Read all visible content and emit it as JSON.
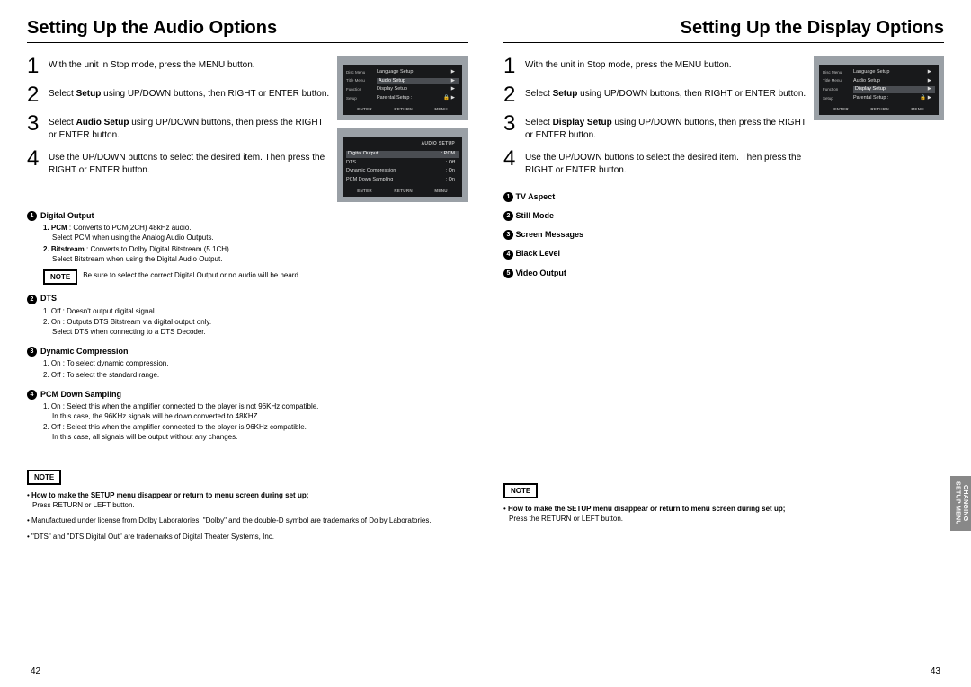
{
  "left": {
    "title": "Setting Up the Audio Options",
    "steps": [
      {
        "num": "1",
        "text": "With the unit in Stop mode, press the MENU button."
      },
      {
        "num": "2",
        "pre": "Select ",
        "bold": "Setup",
        "post": " using UP/DOWN buttons, then RIGHT or ENTER button."
      },
      {
        "num": "3",
        "pre": "Select ",
        "bold": "Audio Setup",
        "post": " using UP/DOWN buttons, then press the RIGHT or ENTER button."
      },
      {
        "num": "4",
        "text": "Use the UP/DOWN buttons to select the desired item. Then press the RIGHT or ENTER button."
      }
    ],
    "osd1": {
      "side": [
        "Disc Menu",
        "Title Menu",
        "Function",
        "Setup"
      ],
      "rows": [
        {
          "label": "Language Setup",
          "val": "▶"
        },
        {
          "label": "Audio Setup",
          "val": "▶",
          "hl": true
        },
        {
          "label": "Display Setup",
          "val": "▶"
        },
        {
          "label": "Parental Setup :",
          "val": "🔒 ▶"
        }
      ],
      "footer": [
        "ENTER",
        "RETURN",
        "MENU"
      ]
    },
    "osd2": {
      "title": "AUDIO SETUP",
      "rows": [
        {
          "label": "Digital Output",
          "val": ": PCM",
          "hl": true
        },
        {
          "label": "DTS",
          "val": ": Off"
        },
        {
          "label": "Dynamic Compression",
          "val": ": On"
        },
        {
          "label": "PCM Down Sampling",
          "val": ": On"
        }
      ],
      "footer": [
        "ENTER",
        "RETURN",
        "MENU"
      ]
    },
    "opts": {
      "o1": {
        "num": "1",
        "head": "Digital Output",
        "subs": [
          {
            "lead": "1. PCM",
            "text": " : Converts to PCM(2CH) 48kHz audio.",
            "cont": "Select PCM when using the Analog Audio Outputs."
          },
          {
            "lead": "2. Bitstream",
            "text": " : Converts to Dolby Digital Bitstream (5.1CH).",
            "cont": "Select Bitstream when using the Digital Audio Output."
          }
        ],
        "note": "Be sure to select the correct Digital Output or no audio will be heard."
      },
      "o2": {
        "num": "2",
        "head": "DTS",
        "subs": [
          {
            "lead": "",
            "text": "1. Off : Doesn't output digital signal."
          },
          {
            "lead": "",
            "text": "2. On : Outputs DTS Bitstream via digital output only.",
            "cont": "Select DTS when connecting to a DTS Decoder."
          }
        ]
      },
      "o3": {
        "num": "3",
        "head": "Dynamic Compression",
        "subs": [
          {
            "lead": "",
            "text": "1. On : To select dynamic compression."
          },
          {
            "lead": "",
            "text": "2. Off : To select the standard range."
          }
        ]
      },
      "o4": {
        "num": "4",
        "head": "PCM Down Sampling",
        "subs": [
          {
            "lead": "",
            "text": "1. On : Select this when the amplifier connected to the player is not 96KHz compatible.",
            "cont": "In this case, the 96KHz signals will be down converted to 48KHZ."
          },
          {
            "lead": "",
            "text": "2. Off : Select this when the amplifier connected to the player is 96KHz compatible.",
            "cont": "In this case, all signals will be output without any changes."
          }
        ]
      }
    },
    "footnote": {
      "label": "NOTE",
      "lines": [
        {
          "bold": "How to make the SETUP menu disappear or return to menu screen during set up;",
          "plain": "Press RETURN or LEFT button."
        },
        {
          "plain": "Manufactured under license from Dolby Laboratories. \"Dolby\" and the double-D symbol are trademarks of Dolby Laboratories."
        },
        {
          "plain": "\"DTS\" and \"DTS Digital Out\" are trademarks of Digital Theater Systems, Inc."
        }
      ]
    },
    "page": "42"
  },
  "right": {
    "title": "Setting Up the Display Options",
    "steps": [
      {
        "num": "1",
        "text": "With the unit in Stop mode, press the MENU button."
      },
      {
        "num": "2",
        "pre": "Select ",
        "bold": "Setup",
        "post": " using UP/DOWN buttons, then RIGHT or ENTER button."
      },
      {
        "num": "3",
        "pre": "Select ",
        "bold": "Display Setup",
        "post": " using UP/DOWN buttons, then press the RIGHT or ENTER button."
      },
      {
        "num": "4",
        "text": "Use the UP/DOWN buttons to select the desired item. Then press the RIGHT or ENTER button."
      }
    ],
    "osd1": {
      "side": [
        "Disc Menu",
        "Title Menu",
        "Function",
        "Setup"
      ],
      "rows": [
        {
          "label": "Language Setup",
          "val": "▶"
        },
        {
          "label": "Audio Setup",
          "val": "▶"
        },
        {
          "label": "Display Setup",
          "val": "▶",
          "hl": true
        },
        {
          "label": "Parental Setup :",
          "val": "🔒 ▶"
        }
      ],
      "footer": [
        "ENTER",
        "RETURN",
        "MENU"
      ]
    },
    "display_opts": [
      {
        "n": "1",
        "t": "TV Aspect"
      },
      {
        "n": "2",
        "t": "Still Mode"
      },
      {
        "n": "3",
        "t": "Screen Messages"
      },
      {
        "n": "4",
        "t": "Black Level"
      },
      {
        "n": "5",
        "t": "Video Output"
      }
    ],
    "footnote": {
      "label": "NOTE",
      "lines": [
        {
          "bold": "How to make the SETUP menu disappear or return to menu screen during set up;",
          "plain": "Press the RETURN or LEFT button."
        }
      ]
    },
    "sidetab_l1": "CHANGING",
    "sidetab_l2": "SETUP MENU",
    "page": "43"
  },
  "note_label": "NOTE"
}
